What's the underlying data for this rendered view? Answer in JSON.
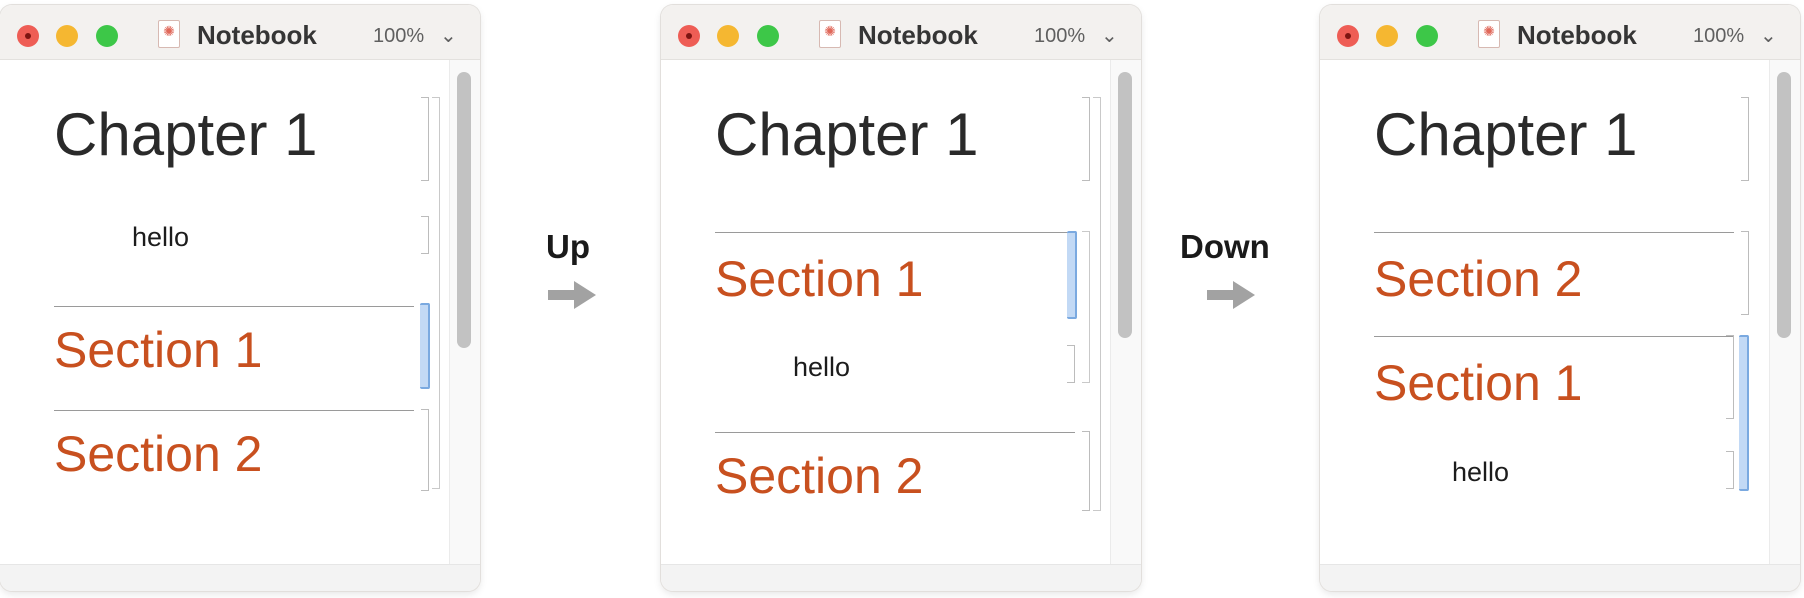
{
  "windows": [
    {
      "title": "Notebook",
      "zoom": "100%",
      "cells": [
        {
          "type": "chapter",
          "text": "Chapter 1"
        },
        {
          "type": "text",
          "text": "hello"
        },
        {
          "type": "section",
          "text": "Section 1",
          "selected": true
        },
        {
          "type": "section",
          "text": "Section 2"
        }
      ]
    },
    {
      "title": "Notebook",
      "zoom": "100%",
      "cells": [
        {
          "type": "chapter",
          "text": "Chapter 1"
        },
        {
          "type": "section",
          "text": "Section 1",
          "selected": true
        },
        {
          "type": "text",
          "text": "hello"
        },
        {
          "type": "section",
          "text": "Section 2"
        }
      ]
    },
    {
      "title": "Notebook",
      "zoom": "100%",
      "cells": [
        {
          "type": "chapter",
          "text": "Chapter 1"
        },
        {
          "type": "section",
          "text": "Section 2"
        },
        {
          "type": "section",
          "text": "Section 1",
          "selected": true
        },
        {
          "type": "text",
          "text": "hello"
        }
      ]
    }
  ],
  "transitions": [
    {
      "label": "Up"
    },
    {
      "label": "Down"
    }
  ],
  "icons": {
    "close": "close-button-icon",
    "minimize": "minimize-button-icon",
    "zoom": "zoom-button-icon",
    "document": "notebook-document-icon",
    "chevron": "chevron-down-icon",
    "arrow": "right-arrow-icon"
  },
  "colors": {
    "section_text": "#c8501f",
    "selection_bracket": "#c2d9f5",
    "arrow": "#a2a2a2"
  }
}
